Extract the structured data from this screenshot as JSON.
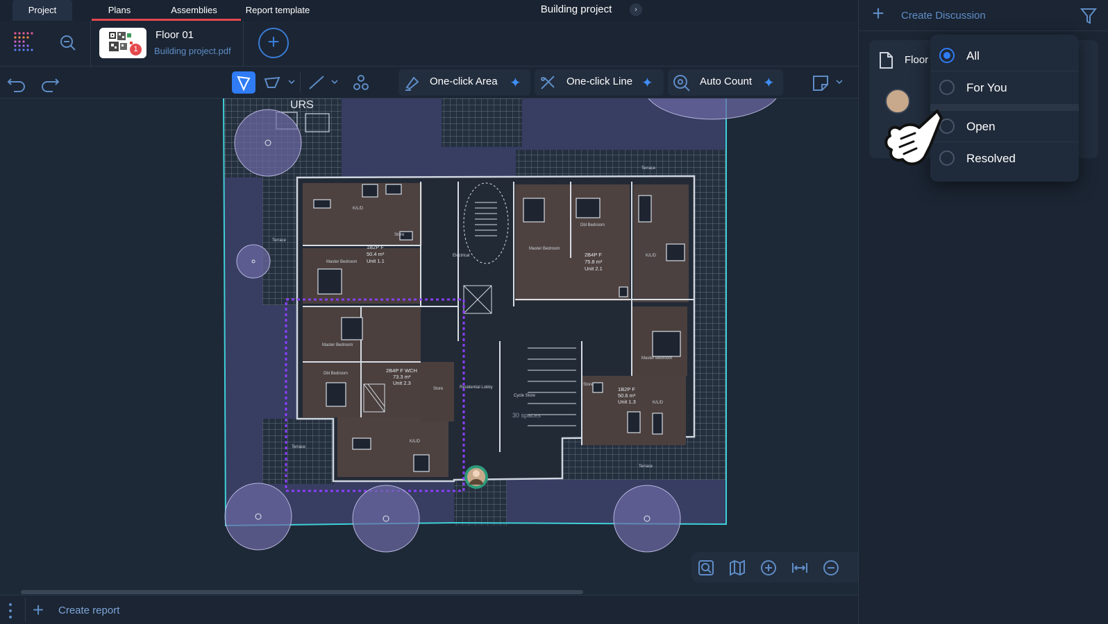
{
  "top_tabs": {
    "project": "Project",
    "plans": "Plans",
    "assemblies": "Assemblies",
    "report_template": "Report template"
  },
  "project_title": "Building project",
  "plan": {
    "name": "Floor 01",
    "file": "Building project.pdf",
    "badge": "1"
  },
  "toolbar": {
    "one_click_area": "One-click Area",
    "one_click_line": "One-click Line",
    "auto_count": "Auto Count"
  },
  "drawing": {
    "label_urs": "URS",
    "units": [
      {
        "name": "1B2P F",
        "area": "50.4 m²",
        "unit": "Unit 1.1"
      },
      {
        "name": "2B4P F",
        "area": "75.8 m²",
        "unit": "Unit 2.1"
      },
      {
        "name": "2B4P F WCH",
        "area": "73.3 m²",
        "unit": "Unit 2.3"
      },
      {
        "name": "1B2P F",
        "area": "50.6 m²",
        "unit": "Unit 1.3"
      }
    ],
    "rooms": [
      "K/L/D",
      "Master Bedroom",
      "Dbl Bedroom",
      "Store",
      "Terrace",
      "Residential Lobby",
      "Cycle Store",
      "30 spaces",
      "Electrical Riser"
    ]
  },
  "bottom": {
    "create_report": "Create report"
  },
  "right_panel": {
    "create_discussion": "Create Discussion",
    "floor_label": "Floor",
    "filter_options": [
      {
        "label": "All",
        "selected": true
      },
      {
        "label": "For You",
        "selected": false
      },
      {
        "label": "Open",
        "selected": false
      },
      {
        "label": "Resolved",
        "selected": false
      }
    ]
  },
  "colors": {
    "accent": "#2f7cf5",
    "badge": "#e5484d",
    "link": "#5f8dc7",
    "selection": "#8a3ffc",
    "boundary": "#3fd0d8"
  }
}
